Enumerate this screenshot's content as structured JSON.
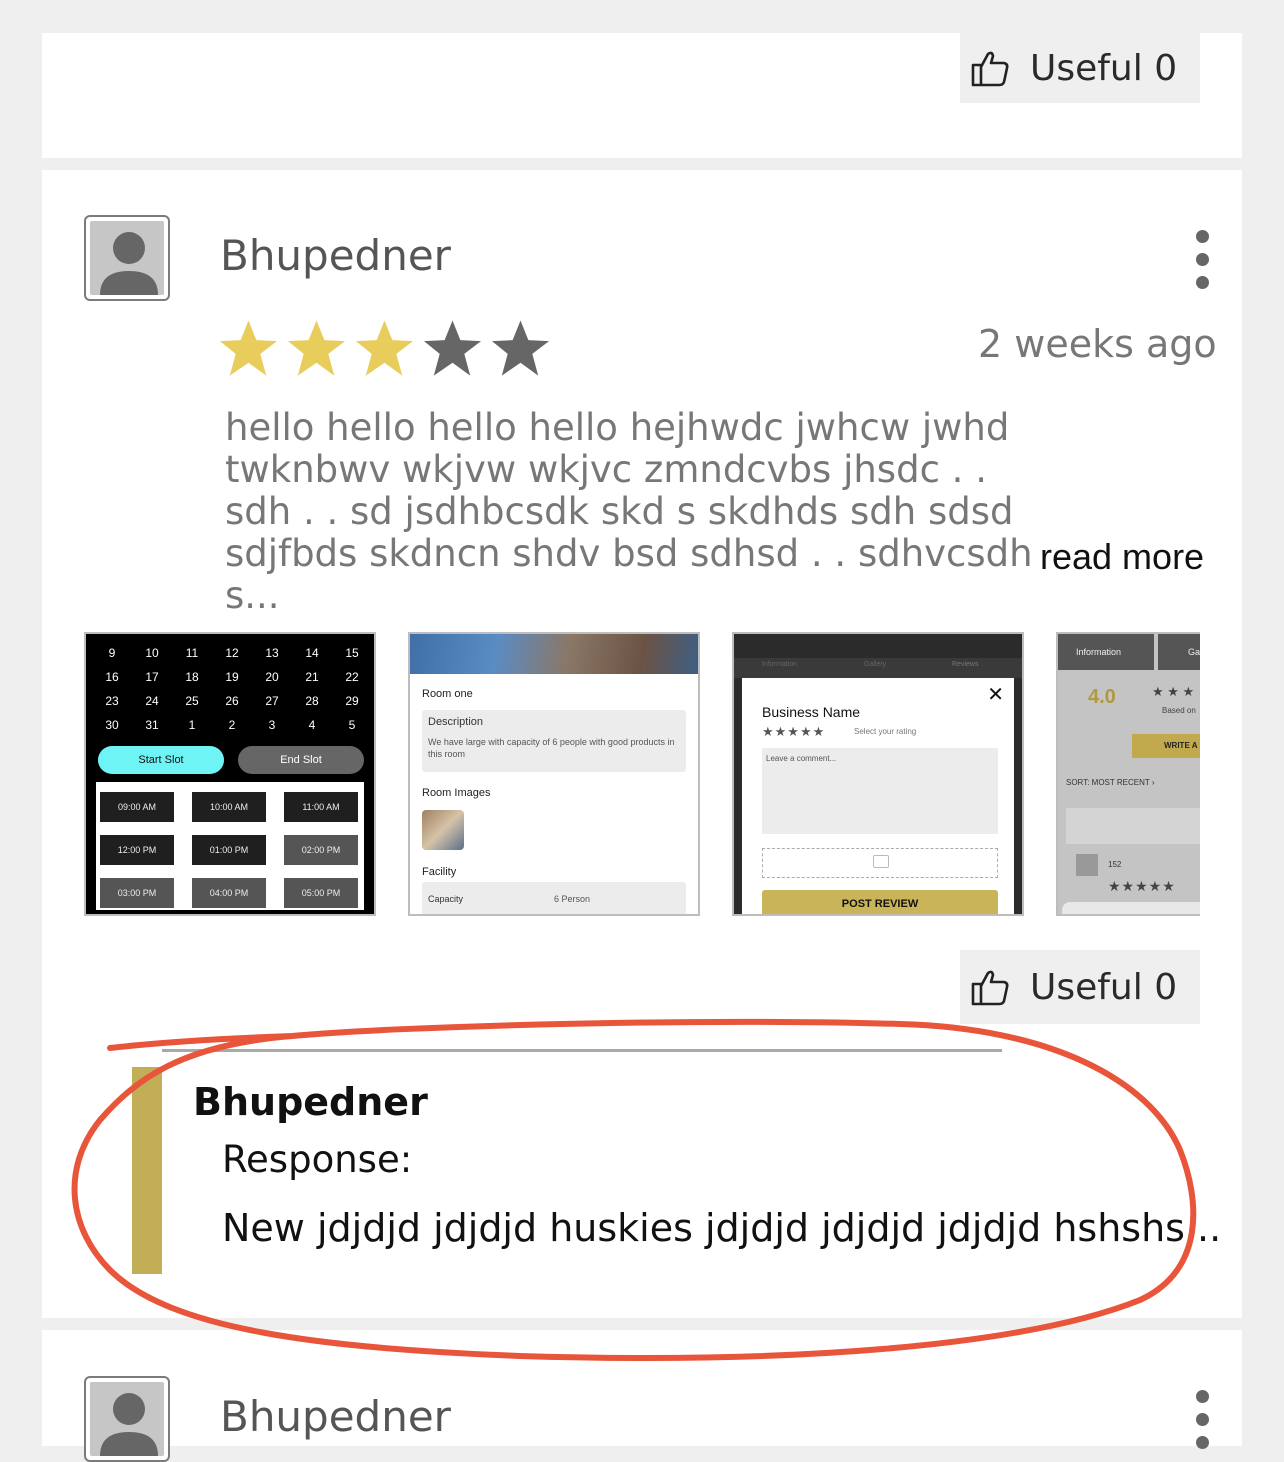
{
  "top_card": {
    "useful_label": "Useful 0"
  },
  "review": {
    "author": "Bhupedner",
    "rating": 3,
    "rating_max": 5,
    "date": "2 weeks ago",
    "text_lines": [
      "hello hello hello hello hejhwdc jwhcw jwhd",
      "twknbwv wkjvw wkjvc zmndcvbs jhsdc . .",
      "sdh . . sd jsdhbcsdk skd s skdhds sdh sdsd",
      "sdjfbds skdncn shdv bsd sdhsd . . sdhvcsdh s..."
    ],
    "read_more": "read more",
    "useful_label": "Useful 0",
    "colors": {
      "star_filled": "#e8cc5c",
      "star_empty": "#666666"
    },
    "thumbnails": {
      "calendar": {
        "days": [
          "9",
          "10",
          "11",
          "12",
          "13",
          "14",
          "15",
          "16",
          "17",
          "18",
          "19",
          "20",
          "21",
          "22",
          "23",
          "24",
          "25",
          "26",
          "27",
          "28",
          "29",
          "30",
          "31",
          "1",
          "2",
          "3",
          "4",
          "5"
        ],
        "start_slot": "Start Slot",
        "end_slot": "End Slot",
        "slots": [
          "09:00 AM",
          "10:00 AM",
          "11:00 AM",
          "12:00 PM",
          "01:00 PM",
          "02:00 PM",
          "03:00 PM",
          "04:00 PM",
          "05:00 PM"
        ]
      },
      "room": {
        "title": "Room one",
        "description_label": "Description",
        "description_text": "We have large with capacity of 6 people with good products in this room",
        "images_label": "Room Images",
        "facility_label": "Facility",
        "capacity_label": "Capacity",
        "capacity_value": "6 Person"
      },
      "review_form": {
        "tabs": [
          "Information",
          "Gallery",
          "Reviews"
        ],
        "business_name": "Business Name",
        "select_rating": "Select your rating",
        "comment_placeholder": "Leave a comment...",
        "post_button": "POST REVIEW"
      },
      "reviews_page": {
        "tab_information": "Information",
        "tab_gallery": "Ga",
        "score": "4.0",
        "based_on": "Based on",
        "write_button": "WRITE A",
        "sort_label": "SORT:",
        "sort_value": "MOST RECENT",
        "count": "152"
      }
    },
    "response": {
      "author": "Bhupedner",
      "label": "Response:",
      "text": "New jdjdjd jdjdjd huskies jdjdjd jdjdjd jdjdjd hshshs...",
      "accent_color": "#c2ae57"
    }
  },
  "next_review": {
    "author": "Bhupedner"
  },
  "annotation": {
    "color": "#e8553a"
  }
}
